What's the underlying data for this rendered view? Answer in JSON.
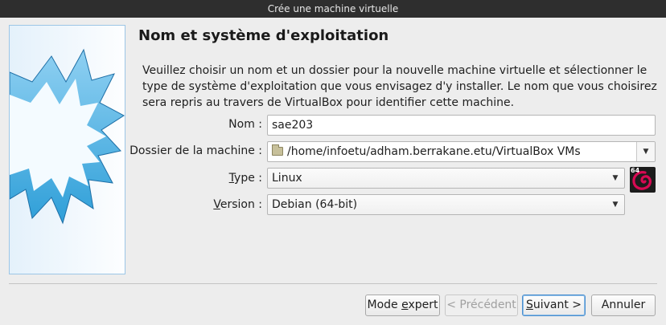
{
  "window": {
    "title": "Crée une machine virtuelle"
  },
  "page": {
    "heading": "Nom et système d'exploitation",
    "description": "Veuillez choisir un nom et un dossier pour la nouvelle machine virtuelle et sélectionner le type de système d'exploitation que vous envisagez d'y installer. Le nom que vous choisirez sera repris au travers de VirtualBox pour identifier cette machine."
  },
  "form": {
    "name": {
      "label": "Nom :",
      "value": "sae203"
    },
    "folder": {
      "label": "Dossier de la machine :",
      "value": "/home/infoetu/adham.berrakane.etu/VirtualBox VMs",
      "icon": "folder-icon"
    },
    "type": {
      "label_mnemonic": "T",
      "label_rest": "ype :",
      "value": "Linux"
    },
    "version": {
      "label_mnemonic": "V",
      "label_rest": "ersion :",
      "value": "Debian (64-bit)"
    },
    "os_icon": {
      "badge": "64",
      "icon": "debian-logo-icon",
      "color": "#d70a53"
    }
  },
  "buttons": {
    "expert": {
      "prefix": "Mode ",
      "mnemonic": "e",
      "suffix": "xpert"
    },
    "previous": {
      "label": "< Précédent"
    },
    "next": {
      "mnemonic": "S",
      "suffix": "uivant >"
    },
    "cancel": {
      "label": "Annuler"
    }
  },
  "colors": {
    "titlebar": "#2e2e2e",
    "accent": "#4a8fcf",
    "sky": "#cfe6f7"
  }
}
